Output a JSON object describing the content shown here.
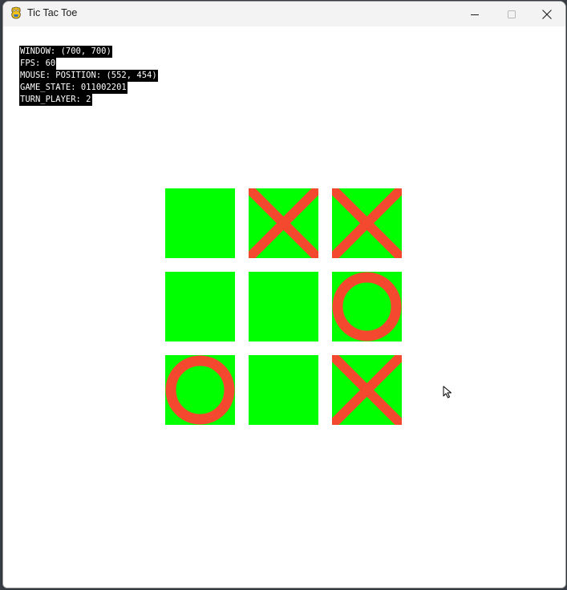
{
  "window": {
    "title": "Tic Tac Toe",
    "controls": {
      "minimize": "minimize-icon",
      "maximize": "maximize-icon",
      "close": "close-icon"
    }
  },
  "debug": {
    "window_line": "WINDOW: (700, 700)",
    "fps_line": "FPS: 60",
    "mouse_line": "MOUSE: POSITION: (552, 454)",
    "state_line": "GAME_STATE: 011002201",
    "turn_line": "TURN_PLAYER: 2"
  },
  "game": {
    "state": "011002201",
    "turn_player": 2,
    "cells": [
      {
        "mark": "empty"
      },
      {
        "mark": "X"
      },
      {
        "mark": "X"
      },
      {
        "mark": "empty"
      },
      {
        "mark": "empty"
      },
      {
        "mark": "O"
      },
      {
        "mark": "O"
      },
      {
        "mark": "empty"
      },
      {
        "mark": "X"
      }
    ]
  },
  "colors": {
    "cell": "#00ff00",
    "mark": "#f4492e",
    "debug_bg": "#000000",
    "debug_fg": "#ffffff"
  }
}
